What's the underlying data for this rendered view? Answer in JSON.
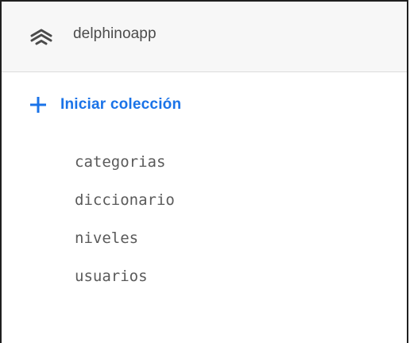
{
  "header": {
    "icon": "database-stack-icon",
    "project_name": "delphinoapp"
  },
  "actions": {
    "start_collection_icon": "plus-icon",
    "start_collection_label": "Iniciar colección",
    "accent_color": "#1a73e8"
  },
  "collections": [
    {
      "label": "categorias"
    },
    {
      "label": "diccionario"
    },
    {
      "label": "niveles"
    },
    {
      "label": "usuarios"
    }
  ]
}
